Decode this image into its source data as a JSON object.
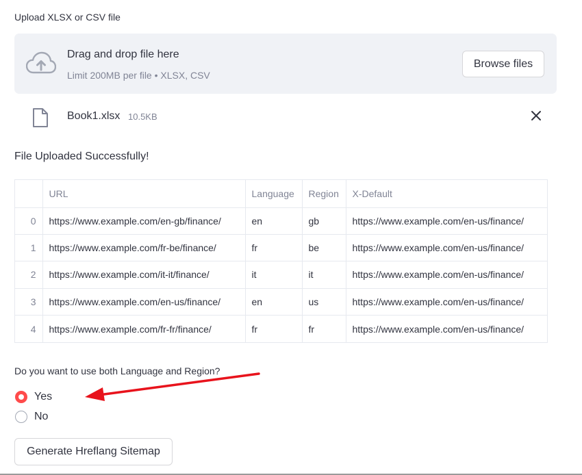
{
  "uploader": {
    "label": "Upload XLSX or CSV file",
    "drop_title": "Drag and drop file here",
    "drop_subtitle": "Limit 200MB per file • XLSX, CSV",
    "browse_label": "Browse files",
    "icons": {
      "upload": "cloud-upload-icon",
      "file": "file-icon",
      "remove": "close-icon"
    }
  },
  "uploaded_file": {
    "name": "Book1.xlsx",
    "size": "10.5KB"
  },
  "status_message": "File Uploaded Successfully!",
  "table": {
    "columns": [
      "",
      "URL",
      "Language",
      "Region",
      "X-Default"
    ],
    "rows": [
      [
        "0",
        "https://www.example.com/en-gb/finance/",
        "en",
        "gb",
        "https://www.example.com/en-us/finance/"
      ],
      [
        "1",
        "https://www.example.com/fr-be/finance/",
        "fr",
        "be",
        "https://www.example.com/en-us/finance/"
      ],
      [
        "2",
        "https://www.example.com/it-it/finance/",
        "it",
        "it",
        "https://www.example.com/en-us/finance/"
      ],
      [
        "3",
        "https://www.example.com/en-us/finance/",
        "en",
        "us",
        "https://www.example.com/en-us/finance/"
      ],
      [
        "4",
        "https://www.example.com/fr-fr/finance/",
        "fr",
        "fr",
        "https://www.example.com/en-us/finance/"
      ]
    ]
  },
  "question": {
    "label": "Do you want to use both Language and Region?",
    "options": [
      "Yes",
      "No"
    ],
    "selected": "Yes"
  },
  "generate_button": "Generate Hreflang Sitemap",
  "colors": {
    "accent": "#ff4b4b",
    "annotation_arrow": "#e8131c",
    "dropzone_bg": "#f0f2f6",
    "text": "#31333f",
    "muted": "#808495"
  }
}
